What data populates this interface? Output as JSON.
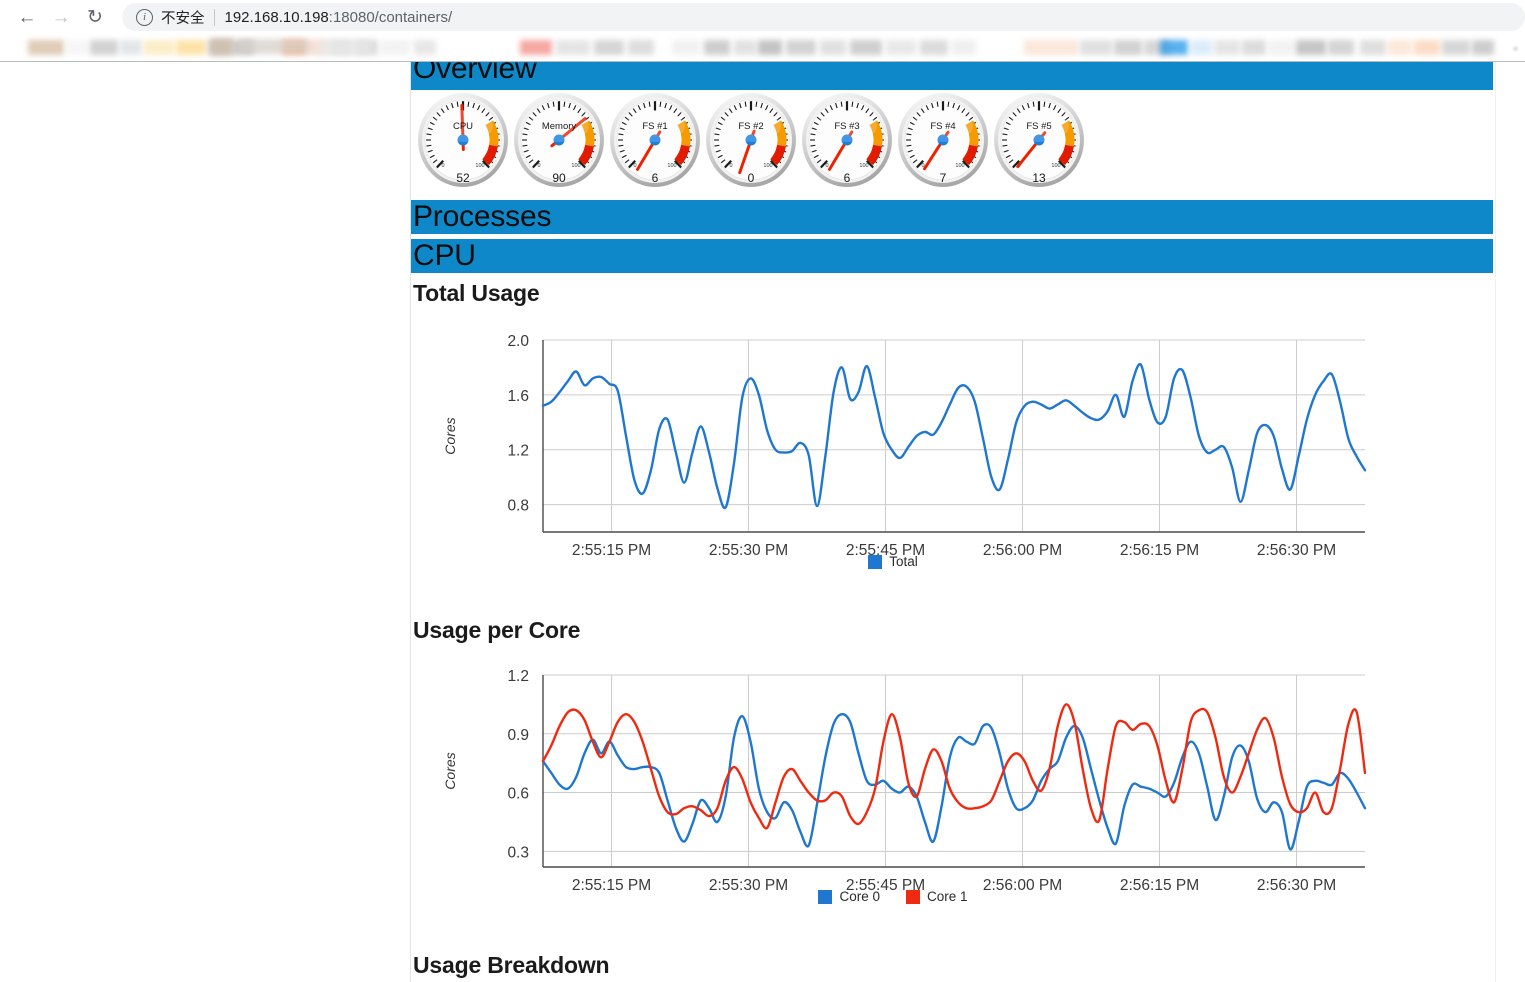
{
  "browser": {
    "back_icon": "back-arrow-icon",
    "forward_icon": "forward-arrow-icon",
    "reload_icon": "reload-icon",
    "info_glyph": "i",
    "security_text": "不安全",
    "url_host": "192.168.10.198",
    "url_rest": ":18080/containers/",
    "bookmark_overflow": "»"
  },
  "sections": {
    "overview": "Overview",
    "processes": "Processes",
    "cpu": "CPU"
  },
  "gauges": [
    {
      "label": "CPU",
      "value": "52",
      "angle": -2,
      "min": "0",
      "max": "100"
    },
    {
      "label": "Memory",
      "value": "90",
      "angle": 52,
      "min": "0",
      "max": "100"
    },
    {
      "label": "FS #1",
      "value": "6",
      "angle": -148,
      "min": "0",
      "max": "100"
    },
    {
      "label": "FS #2",
      "value": "0",
      "angle": -160,
      "min": "0",
      "max": "100"
    },
    {
      "label": "FS #3",
      "value": "6",
      "angle": -148,
      "min": "0",
      "max": "100"
    },
    {
      "label": "FS #4",
      "value": "7",
      "angle": -146,
      "min": "0",
      "max": "100"
    },
    {
      "label": "FS #5",
      "value": "13",
      "angle": -140,
      "min": "0",
      "max": "100"
    }
  ],
  "headings": {
    "total_usage": "Total Usage",
    "usage_per_core": "Usage per Core",
    "usage_breakdown": "Usage Breakdown"
  },
  "colors": {
    "accent": "#0e88c8",
    "series_blue": "#1f77d0",
    "series_red": "#f02a10",
    "grid": "#cccccc"
  },
  "chart_data": [
    {
      "id": "total-usage",
      "type": "line",
      "title": "Total Usage",
      "xlabel": "",
      "ylabel": "Cores",
      "ylim": [
        0.6,
        2.0
      ],
      "yticks": [
        "2.0",
        "1.6",
        "1.2",
        "0.8"
      ],
      "ytick_values": [
        2.0,
        1.6,
        1.2,
        0.8
      ],
      "xticks": [
        "2:55:15 PM",
        "2:55:30 PM",
        "2:55:45 PM",
        "2:56:00 PM",
        "2:56:15 PM",
        "2:56:30 PM"
      ],
      "grid": true,
      "legend_position": "bottom",
      "series": [
        {
          "name": "Total",
          "color": "#1f77d0",
          "values": [
            1.52,
            1.55,
            1.62,
            1.7,
            1.77,
            1.67,
            1.72,
            1.73,
            1.68,
            1.63,
            1.3,
            0.98,
            0.88,
            1.05,
            1.35,
            1.42,
            1.18,
            0.96,
            1.18,
            1.37,
            1.18,
            0.92,
            0.78,
            1.1,
            1.58,
            1.72,
            1.6,
            1.34,
            1.2,
            1.18,
            1.19,
            1.25,
            1.16,
            0.79,
            1.15,
            1.62,
            1.8,
            1.57,
            1.62,
            1.81,
            1.58,
            1.32,
            1.2,
            1.14,
            1.22,
            1.3,
            1.33,
            1.31,
            1.4,
            1.53,
            1.65,
            1.66,
            1.55,
            1.28,
            1.0,
            0.91,
            1.13,
            1.4,
            1.52,
            1.55,
            1.53,
            1.5,
            1.53,
            1.56,
            1.52,
            1.47,
            1.43,
            1.42,
            1.48,
            1.6,
            1.44,
            1.7,
            1.82,
            1.57,
            1.4,
            1.44,
            1.72,
            1.78,
            1.58,
            1.3,
            1.18,
            1.2,
            1.22,
            1.07,
            0.82,
            1.05,
            1.32,
            1.38,
            1.3,
            1.06,
            0.91,
            1.15,
            1.42,
            1.6,
            1.7,
            1.75,
            1.55,
            1.28,
            1.15,
            1.05
          ]
        }
      ]
    },
    {
      "id": "usage-per-core",
      "type": "line",
      "title": "Usage per Core",
      "xlabel": "",
      "ylabel": "Cores",
      "ylim": [
        0.22,
        1.2
      ],
      "yticks": [
        "1.2",
        "0.9",
        "0.6",
        "0.3"
      ],
      "ytick_values": [
        1.2,
        0.9,
        0.6,
        0.3
      ],
      "xticks": [
        "2:55:15 PM",
        "2:55:30 PM",
        "2:55:45 PM",
        "2:56:00 PM",
        "2:56:15 PM",
        "2:56:30 PM"
      ],
      "grid": true,
      "legend_position": "bottom",
      "series": [
        {
          "name": "Core 0",
          "color": "#1f77d0",
          "values": [
            0.76,
            0.7,
            0.64,
            0.62,
            0.68,
            0.8,
            0.87,
            0.8,
            0.86,
            0.79,
            0.73,
            0.72,
            0.73,
            0.73,
            0.7,
            0.56,
            0.42,
            0.35,
            0.44,
            0.56,
            0.52,
            0.45,
            0.58,
            0.88,
            0.99,
            0.86,
            0.62,
            0.5,
            0.47,
            0.55,
            0.51,
            0.4,
            0.33,
            0.54,
            0.78,
            0.95,
            1.0,
            0.96,
            0.8,
            0.66,
            0.64,
            0.66,
            0.62,
            0.6,
            0.63,
            0.58,
            0.45,
            0.35,
            0.53,
            0.78,
            0.88,
            0.86,
            0.85,
            0.94,
            0.93,
            0.8,
            0.62,
            0.52,
            0.52,
            0.56,
            0.66,
            0.72,
            0.76,
            0.88,
            0.94,
            0.88,
            0.72,
            0.56,
            0.42,
            0.34,
            0.53,
            0.64,
            0.63,
            0.62,
            0.6,
            0.58,
            0.65,
            0.78,
            0.86,
            0.8,
            0.63,
            0.46,
            0.58,
            0.78,
            0.84,
            0.76,
            0.57,
            0.5,
            0.55,
            0.5,
            0.31,
            0.45,
            0.63,
            0.66,
            0.65,
            0.64,
            0.7,
            0.67,
            0.6,
            0.52
          ]
        },
        {
          "name": "Core 1",
          "color": "#f02a10",
          "values": [
            0.76,
            0.84,
            0.94,
            1.01,
            1.02,
            0.97,
            0.86,
            0.78,
            0.86,
            0.96,
            1.0,
            0.96,
            0.86,
            0.72,
            0.58,
            0.5,
            0.49,
            0.52,
            0.53,
            0.51,
            0.48,
            0.52,
            0.66,
            0.73,
            0.67,
            0.55,
            0.47,
            0.42,
            0.55,
            0.68,
            0.72,
            0.66,
            0.6,
            0.56,
            0.56,
            0.6,
            0.58,
            0.48,
            0.44,
            0.5,
            0.62,
            0.86,
            1.0,
            0.88,
            0.65,
            0.58,
            0.72,
            0.82,
            0.76,
            0.62,
            0.55,
            0.52,
            0.52,
            0.53,
            0.56,
            0.66,
            0.76,
            0.8,
            0.76,
            0.66,
            0.61,
            0.72,
            0.94,
            1.05,
            0.96,
            0.72,
            0.52,
            0.46,
            0.72,
            0.94,
            0.96,
            0.92,
            0.95,
            0.94,
            0.84,
            0.66,
            0.55,
            0.72,
            0.96,
            1.02,
            1.01,
            0.88,
            0.68,
            0.6,
            0.68,
            0.8,
            0.92,
            0.98,
            0.88,
            0.68,
            0.54,
            0.5,
            0.52,
            0.6,
            0.5,
            0.52,
            0.72,
            0.95,
            1.01,
            0.7
          ]
        }
      ]
    }
  ]
}
